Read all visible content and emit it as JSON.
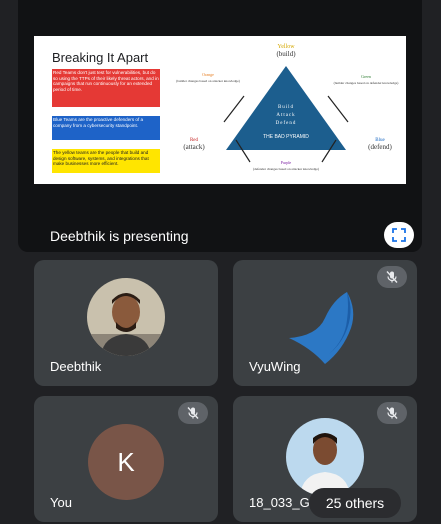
{
  "presentation": {
    "presenter_label": "Deebthik is presenting",
    "slide": {
      "title": "Breaking It Apart",
      "red_text": "Red Teams don't just test for vulnerabilities, but do so using the TTPs of their likely threat actors, and in campaigns that run continuously for an extended period of time.",
      "blue_text": "Blue Teams are the proactive defenders of a company from a cybersecurity standpoint.",
      "yellow_text": "The yellow teams are the people that build and design software, systems, and integrations that make businesses more efficient.",
      "pyramid": {
        "top_color": "Yellow",
        "top_role": "(build)",
        "left_color": "Red",
        "left_role": "(attack)",
        "right_color": "Blue",
        "right_role": "(defend)",
        "bottom_color": "Purple",
        "bottom_note": "(defender changes based on attacker knowledge)",
        "orange_label": "Orange",
        "orange_note": "(builder changes based on attacker knowledge)",
        "green_label": "Green",
        "green_note": "(builder changes based on defender knowledge)",
        "center_words": [
          "Build",
          "Attack",
          "Defend"
        ],
        "caption": "THE BAD PYRAMID"
      }
    }
  },
  "participants": [
    {
      "name": "Deebthik",
      "muted": false
    },
    {
      "name": "VyuWing",
      "muted": true
    },
    {
      "name": "You",
      "initial": "K",
      "muted": true
    },
    {
      "name": "18_033_G",
      "muted": true
    }
  ],
  "others_label": "25 others",
  "colors": {
    "background": "#202124",
    "tile": "#3c4043",
    "k_avatar": "#795548",
    "red": "#e53935",
    "blue": "#1e63c8",
    "yellow": "#ffe500",
    "pyramid": "#1c5e8e"
  }
}
